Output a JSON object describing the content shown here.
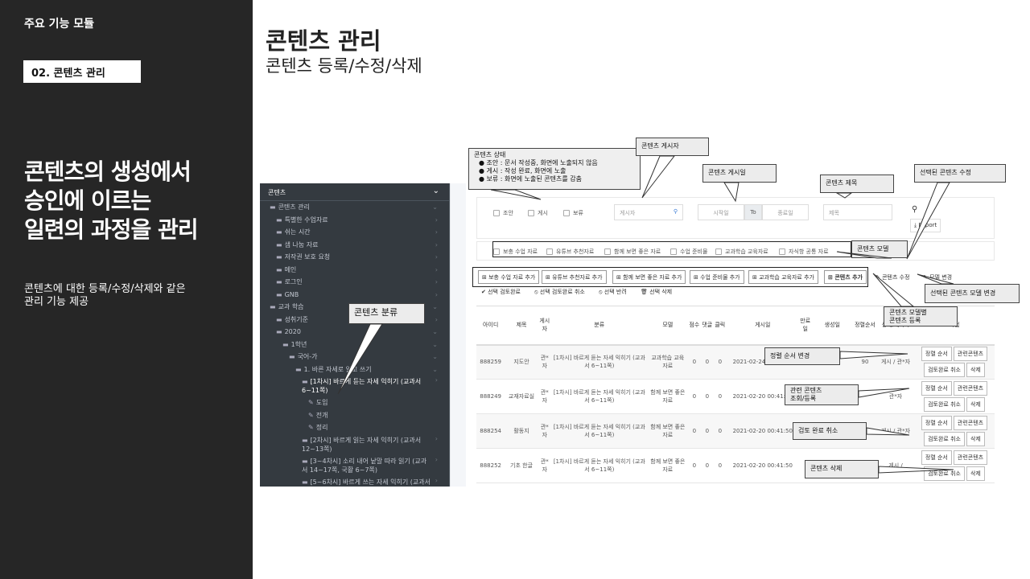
{
  "sidebar": {
    "title": "주요 기능 모듈",
    "badge": "02. 콘텐츠 관리",
    "headline": [
      "콘텐츠의 생성에서",
      "승인에 이르는",
      "일련의 과정을 관리"
    ],
    "desc": [
      "콘텐츠에 대한 등록/수정/삭제와 같은",
      "관리 기능 제공"
    ]
  },
  "main": {
    "title": "콘텐츠 관리",
    "subtitle": "콘텐츠 등록/수정/삭제"
  },
  "tree": {
    "header": "콘텐츠",
    "items": [
      {
        "label": "콘텐츠 관리",
        "indent": 0
      },
      {
        "label": "특별한 수업자료",
        "indent": 1
      },
      {
        "label": "쉬는 시간",
        "indent": 1
      },
      {
        "label": "샘 나눔 자료",
        "indent": 1
      },
      {
        "label": "저작권 보호 요청",
        "indent": 1
      },
      {
        "label": "메인",
        "indent": 1
      },
      {
        "label": "로그인",
        "indent": 1
      },
      {
        "label": "GNB",
        "indent": 1
      },
      {
        "label": "교과 학습",
        "indent": 0
      },
      {
        "label": "성취기준",
        "indent": 1
      },
      {
        "label": "2020",
        "indent": 1
      },
      {
        "label": "1학년",
        "indent": 2
      },
      {
        "label": "국어-가",
        "indent": 3
      },
      {
        "label": "1. 바른 자세로 읽고 쓰기",
        "indent": 4
      },
      {
        "label": "[1차시] 바르게 듣는 자세 익히기 (교과서 6~11쪽)",
        "indent": 5
      },
      {
        "label": "도입",
        "indent": 6
      },
      {
        "label": "전개",
        "indent": 6
      },
      {
        "label": "정리",
        "indent": 6
      },
      {
        "label": "[2차시] 바르게 읽는 자세 익히기 (교과서 12~13쪽)",
        "indent": 5
      },
      {
        "label": "[3~4차시] 소리 내어 낱말 따라 읽기 (교과서 14~17쪽, 국활 6~7쪽)",
        "indent": 5
      },
      {
        "label": "[5~6차시] 바르게 쓰는 자세 익히기 (교과서 18~22쪽)",
        "indent": 5
      }
    ]
  },
  "filters": {
    "status": [
      "조안",
      "게시",
      "보류"
    ],
    "poster_placeholder": "게시자",
    "start_placeholder": "시작일",
    "to": "To",
    "end_placeholder": "종료일",
    "title_placeholder": "제목",
    "export": "Export",
    "models": [
      "보충 수업 자료",
      "유튜브 추천자료",
      "함께 보면 좋은 자료",
      "수업 준비물",
      "교과학습 교육자료",
      "자식항 공통 자료"
    ]
  },
  "buttons": {
    "add": [
      "보충 수업 자료 추가",
      "유튜브 추천자료 추가",
      "함께 보면 좋은 자료 추가",
      "수업 준비물 추가",
      "교과학습 교육자료 추가",
      "콘텐츠 추가"
    ],
    "edit": "콘텐츠 수정",
    "model_change": "모델 변경",
    "row2": [
      "선택 검토완료",
      "선택 검토완료 취소",
      "선택 반려",
      "선택 삭제"
    ]
  },
  "table": {
    "headers": [
      "아이디",
      "제목",
      "게시자",
      "분류",
      "모델",
      "점수",
      "댓글",
      "클릭",
      "게시일",
      "만료일",
      "생성일",
      "정렬순서",
      "상태/게시자",
      "작업"
    ],
    "rows": [
      {
        "id": "888259",
        "title": "지도안",
        "poster": "관*자",
        "category": "[1차시] 바르게 듣는 자세 익히기 (교과서 6~11쪽)",
        "model": "교과학습 교육자료",
        "score": "0",
        "comments": "0",
        "clicks": "0",
        "posted": "2021-02-24 00:41:50",
        "expire": "",
        "created": "",
        "order": "90",
        "status": "게시 / 관*자"
      },
      {
        "id": "888249",
        "title": "교재자료실",
        "poster": "관*자",
        "category": "[1차시] 바르게 듣는 자세 익히기 (교과서 6~11쪽)",
        "model": "함께 보면 좋은 자료",
        "score": "0",
        "comments": "0",
        "clicks": "0",
        "posted": "2021-02-20 00:41:50",
        "expire": "",
        "created": "",
        "order": "",
        "status": "관*자"
      },
      {
        "id": "888254",
        "title": "활동지",
        "poster": "관*자",
        "category": "[1차시] 바르게 듣는 자세 익히기 (교과서 6~11쪽)",
        "model": "함께 보면 좋은 자료",
        "score": "0",
        "comments": "0",
        "clicks": "0",
        "posted": "2021-02-20 00:41:50",
        "expire": "",
        "created": "",
        "order": "",
        "status": "게시 / 관*자"
      },
      {
        "id": "888252",
        "title": "기초 한글",
        "poster": "관*자",
        "category": "[1차시] 바르게 듣는 자세 익히기 (교과서 6~11쪽)",
        "model": "함께 보면 좋은 자료",
        "score": "0",
        "comments": "0",
        "clicks": "0",
        "posted": "2021-02-20 00:41:50",
        "expire": "",
        "created": "2021-02-20",
        "order": "",
        "status": "게시 /"
      }
    ],
    "row_buttons": [
      "정렬 순서",
      "관련콘텐츠",
      "검토완료 취소",
      "삭제"
    ]
  },
  "callouts": {
    "status_title": "콘텐츠 상태",
    "status_lines": [
      "조안 : 문서 작성중, 화면에 노출되지 않음",
      "게시 : 작성 완료, 화면에 노출",
      "보류 : 화면에 노출된 콘텐츠를 감춤"
    ],
    "poster": "콘텐츠 게시자",
    "post_date": "콘텐츠 게시일",
    "title": "콘텐츠 제목",
    "edit_selected": "선택된 콘텐츠 수정",
    "model": "콘텐츠 모델",
    "model_change": "선택된 콘텐츠 모델 변경",
    "per_model": [
      "콘텐츠 모델별",
      "콘텐츠 등록"
    ],
    "category": "콘텐츠 분류",
    "sort": "정렬 순서 변경",
    "related": [
      "관련 콘텐츠",
      "조회/등록"
    ],
    "cancel_review": "검토 완료 취소",
    "delete": "콘텐츠 삭제"
  }
}
